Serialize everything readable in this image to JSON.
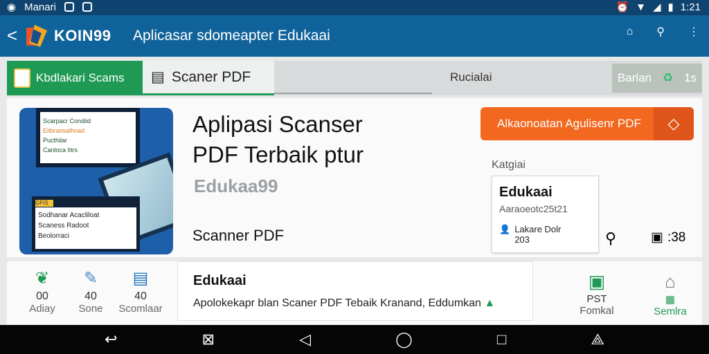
{
  "status": {
    "carrier": "Manari",
    "time": "1:21"
  },
  "appbar": {
    "brand": "KOIN99",
    "title": "Aplicasar sdomeapter Edukaai"
  },
  "tabs": {
    "tab1": "Kbdlakari Scams",
    "tab2": "Scaner PDF",
    "tab3": "Rucialai",
    "tab4": "Barlan",
    "tab4_count": "1s"
  },
  "main": {
    "title_line1": "Aplipasi Scanser",
    "title_line2": "PDF Terbaik ptur",
    "subtitle": "Edukaa99",
    "label": "Scanner PDF",
    "cta": "Alkaonoatan Agulisenr PDF",
    "category_label": "Katgiai",
    "card": {
      "title": "Edukaai",
      "number": "Aaraoeotc25t21",
      "uploader": "Lakare Dolr",
      "year": "203"
    },
    "count": ":38",
    "thumb": {
      "panel1": [
        "Scarpacr Condiid",
        "Eitbraosalhoad",
        "Pucthilar",
        "Canloca Iitrs"
      ],
      "panel2_tag": "GFIS",
      "panel2": [
        "Sodhanar Acacliloat",
        "Scaness Radoot",
        "Beolorraci"
      ]
    }
  },
  "stats": [
    {
      "icon": "leaf-icon",
      "value": "00",
      "label": "Adiay"
    },
    {
      "icon": "pen-icon",
      "value": "40",
      "label": "Sone"
    },
    {
      "icon": "file-icon",
      "value": "40",
      "label": "Scomlaar"
    }
  ],
  "description": {
    "title": "Edukaai",
    "body": "Apolokekapr blan Scaner PDF Tebaik Kranand, Eddumkan"
  },
  "side": [
    {
      "icon": "tool-icon",
      "value": "PST",
      "label": "Fomkal"
    },
    {
      "icon": "home-icon",
      "value": "",
      "label": "Semlra"
    }
  ],
  "colors": {
    "appbar": "#10629a",
    "accent": "#1f9a55",
    "cta": "#f2681e"
  }
}
